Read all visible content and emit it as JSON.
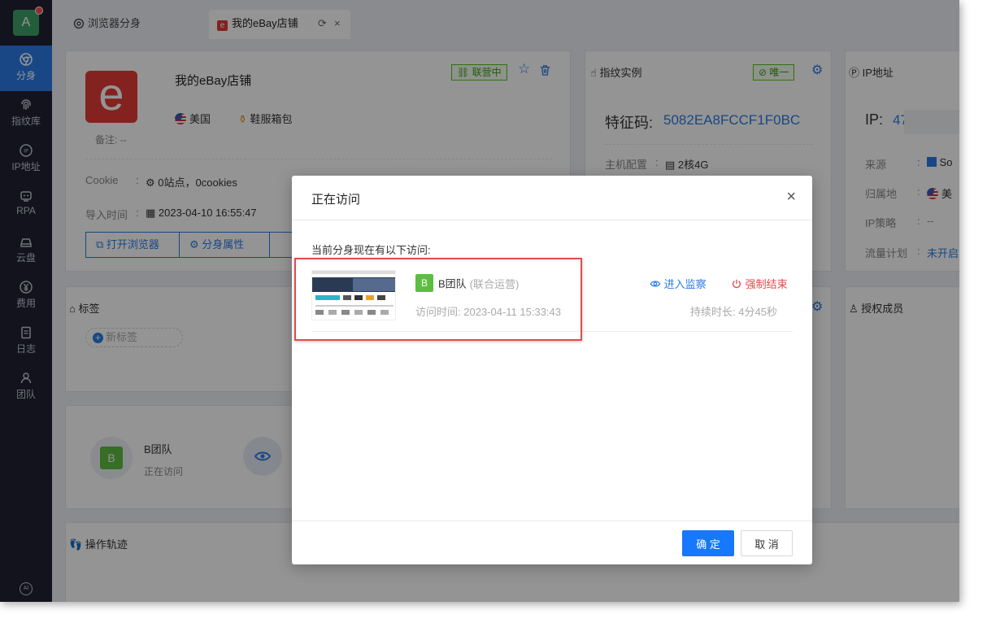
{
  "sidebar": {
    "avatar_letter": "A",
    "items": [
      {
        "label": "分身",
        "icon": "chrome-icon",
        "active": true
      },
      {
        "label": "指纹库",
        "icon": "fingerprint-icon"
      },
      {
        "label": "IP地址",
        "icon": "ip-icon"
      },
      {
        "label": "RPA",
        "icon": "robot-icon"
      },
      {
        "label": "云盘",
        "icon": "cloud-drive-icon"
      },
      {
        "label": "费用",
        "icon": "yen-icon"
      },
      {
        "label": "日志",
        "icon": "log-icon"
      },
      {
        "label": "团队",
        "icon": "team-icon"
      }
    ],
    "bottom_icon_text": "AI"
  },
  "tabs": [
    {
      "label": "浏览器分身"
    },
    {
      "label": "我的eBay店铺",
      "active": true
    }
  ],
  "profile": {
    "logo_letter": "e",
    "name": "我的eBay店铺",
    "status": "联营中",
    "country": "美国",
    "category": "鞋服箱包",
    "note_label": "备注:",
    "note_value": "--",
    "cookie_label": "Cookie",
    "colon": ":",
    "cookie_value": "0站点，0cookies",
    "import_label": "导入时间",
    "import_value": "2023-04-10 16:55:47",
    "open_browser": "打开浏览器",
    "properties": "分身属性"
  },
  "fingerprint": {
    "title": "指纹实例",
    "badge": "唯一",
    "code_label": "特征码:",
    "code_value": "5082EA8FCCF1F0BC",
    "host_label": "主机配置",
    "host_value": "2核4G"
  },
  "ip": {
    "title": "IP地址",
    "ip_label": "IP:",
    "ip_value": "47",
    "source_label": "来源",
    "source_value": "So",
    "location_label": "归属地",
    "location_value": "美",
    "policy_label": "IP策略",
    "policy_value": "--",
    "traffic_label": "流量计划",
    "traffic_value": "未开启"
  },
  "tags": {
    "title": "标签",
    "add_tag": "新标签"
  },
  "visitors": {
    "team_name": "B团队",
    "team_letter": "B",
    "status": "正在访问"
  },
  "authorized": {
    "title": "授权成员"
  },
  "trail": {
    "title": "操作轨迹"
  },
  "modal": {
    "title": "正在访问",
    "subtitle": "当前分身现在有以下访问:",
    "visits": [
      {
        "letter": "B",
        "team": "B团队",
        "role": "(联合运营)",
        "time_label": "访问时间:",
        "time_value": "2023-04-11 15:33:43",
        "monitor_label": "进入监察",
        "force_end_label": "强制结束",
        "duration_label": "持续时长:",
        "duration_value": "4分45秒"
      }
    ],
    "confirm": "确 定",
    "cancel": "取 消"
  },
  "colors": {
    "sidebar_bg": "#1f2233",
    "accent": "#2c7be5",
    "primary_button": "#1677ff",
    "danger": "#e5484d",
    "success": "#52c41a",
    "ebay_red": "#e33b36",
    "highlight_box": "#e34b4b"
  }
}
